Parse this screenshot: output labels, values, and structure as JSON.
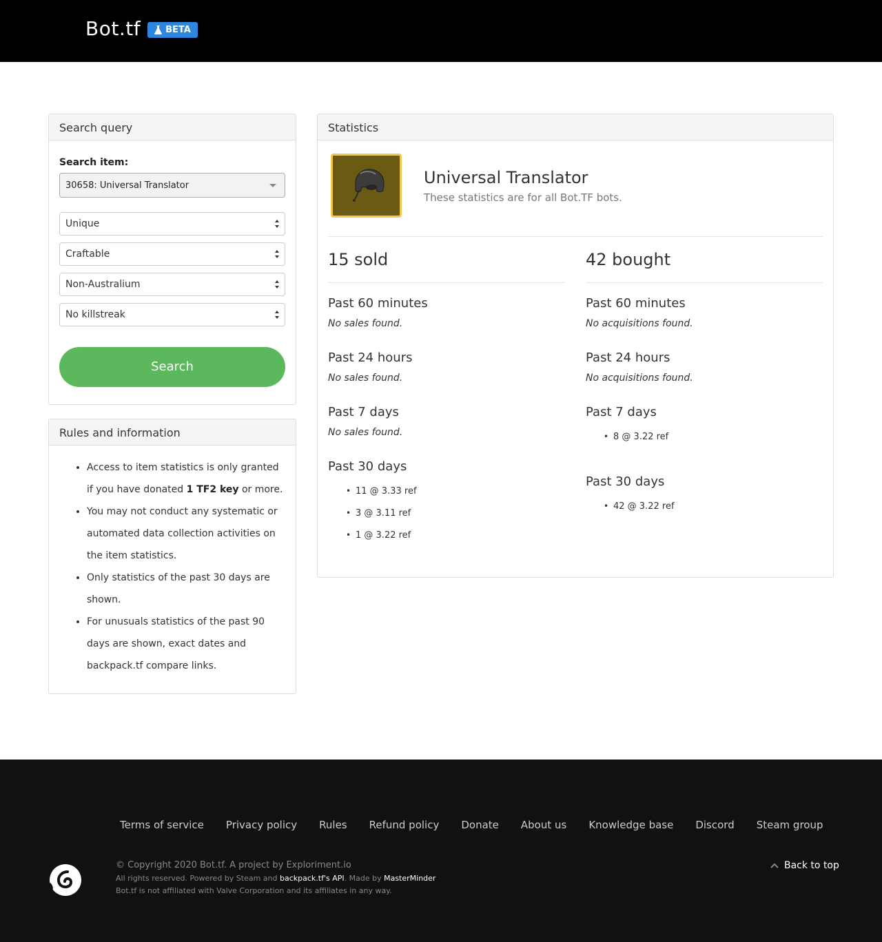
{
  "header": {
    "brand": "Bot.tf",
    "beta_label": "BETA"
  },
  "search": {
    "panel_title": "Search query",
    "item_label": "Search item:",
    "item_value": "30658: Universal Translator",
    "quality": "Unique",
    "craftable": "Craftable",
    "australium": "Non-Australium",
    "killstreak": "No killstreak",
    "button": "Search"
  },
  "rules": {
    "panel_title": "Rules and information",
    "r1_a": "Access to item statistics is only granted if you have donated ",
    "r1_b": "1 TF2 key",
    "r1_c": " or more.",
    "r2": "You may not conduct any systematic or automated data collection activities on the item statistics.",
    "r3": "Only statistics of the past 30 days are shown.",
    "r4": "For unusuals statistics of the past 90 days are shown, exact dates and backpack.tf compare links."
  },
  "stats": {
    "panel_title": "Statistics",
    "item_name": "Universal Translator",
    "item_note": "These statistics are for all Bot.TF bots.",
    "sold": {
      "total": "15 sold",
      "p60_title": "Past 60 minutes",
      "p60": "No sales found.",
      "p24_title": "Past 24 hours",
      "p24": "No sales found.",
      "p7_title": "Past 7 days",
      "p7": "No sales found.",
      "p30_title": "Past 30 days",
      "p30": [
        "11 @ 3.33 ref",
        "3 @ 3.11 ref",
        "1 @ 3.22 ref"
      ]
    },
    "bought": {
      "total": "42 bought",
      "p60_title": "Past 60 minutes",
      "p60": "No acquisitions found.",
      "p24_title": "Past 24 hours",
      "p24": "No acquisitions found.",
      "p7_title": "Past 7 days",
      "p7": [
        "8 @ 3.22 ref"
      ],
      "p30_title": "Past 30 days",
      "p30": [
        "42 @ 3.22 ref"
      ]
    }
  },
  "footer": {
    "links": [
      "Terms of service",
      "Privacy policy",
      "Rules",
      "Refund policy",
      "Donate",
      "About us",
      "Knowledge base",
      "Discord",
      "Steam group"
    ],
    "copyright": "© Copyright 2020 Bot.tf. A project by Exploriment.io",
    "rights_a": "All rights reserved. Powered by Steam and ",
    "rights_link1": "backpack.tf's API",
    "rights_b": ". Made by ",
    "rights_link2": "MasterMinder",
    "disclaimer": "Bot.tf is not affiliated with Valve Corporation and its affiliates in any way.",
    "back_to_top": "Back to top"
  },
  "colors": {
    "header_bg": "#000000",
    "beta": "#2e86de",
    "search_button": "#5cb85c",
    "item_border": "#f2c94c",
    "footer_bg": "#111111"
  },
  "icons": [
    "flask-icon",
    "dropdown-caret-icon",
    "select-arrows-icon",
    "hat-item-image",
    "bottf-logo-icon",
    "chevron-up-icon"
  ]
}
